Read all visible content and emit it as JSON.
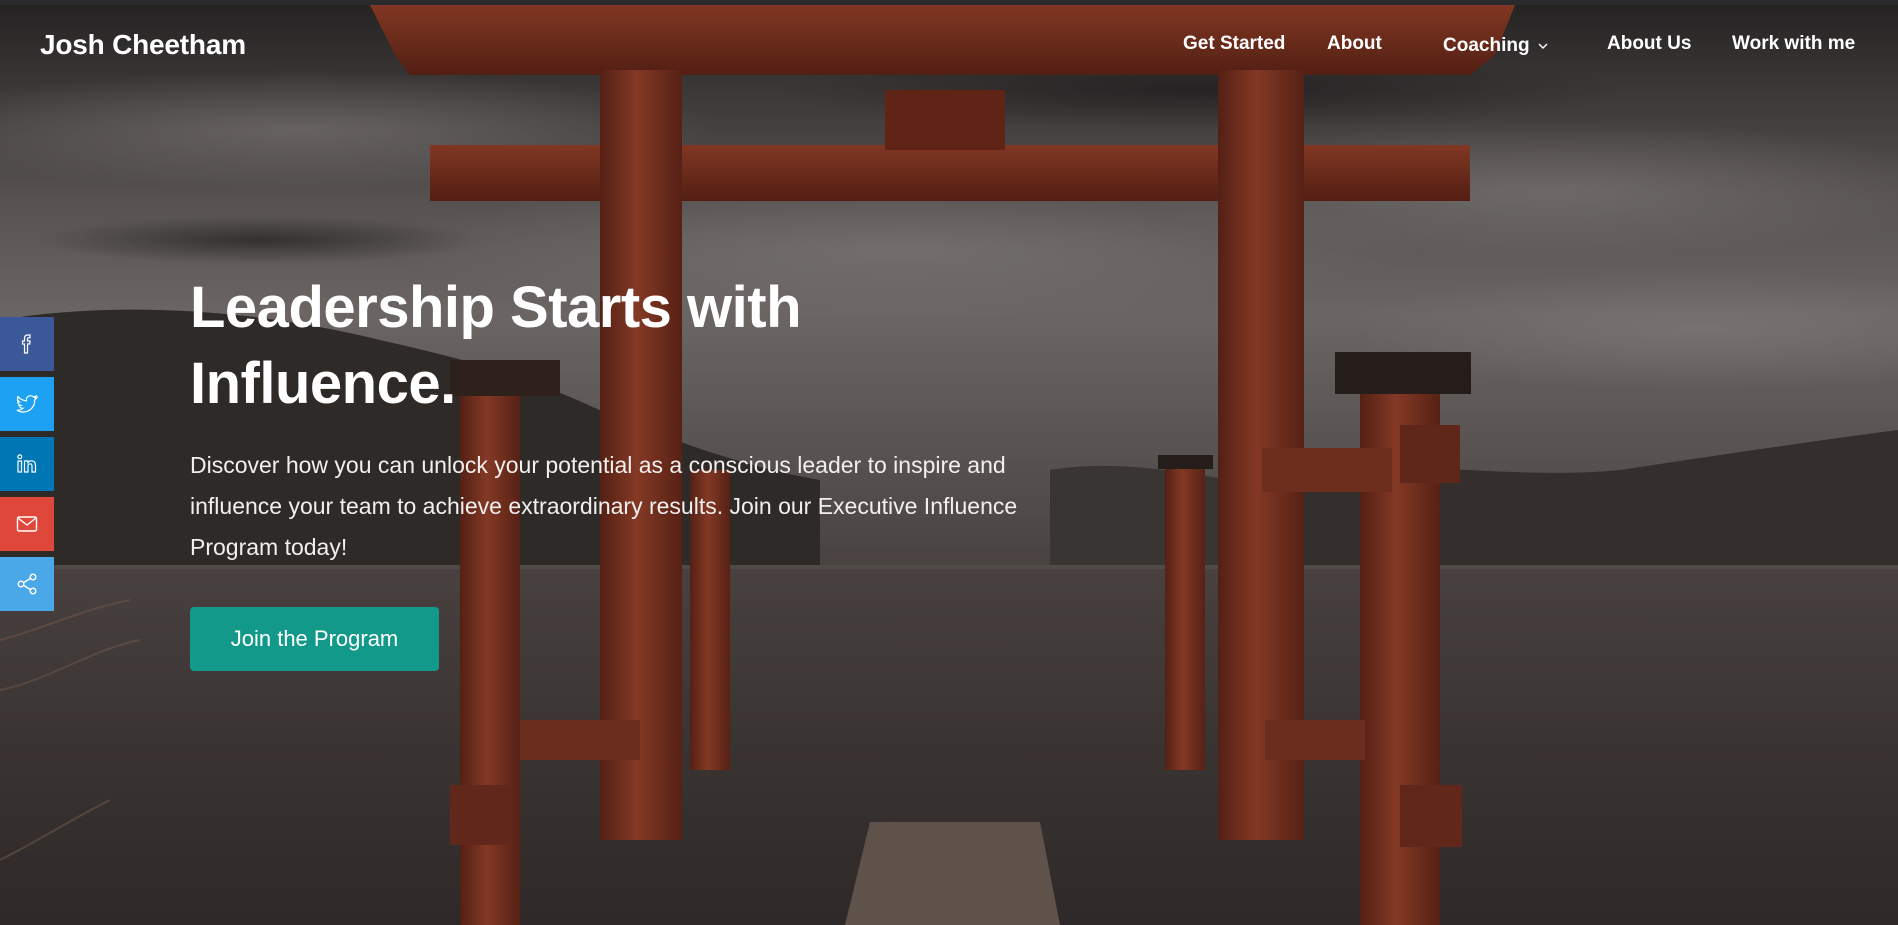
{
  "brand": "Josh Cheetham",
  "nav": {
    "items": [
      {
        "label": "Get Started"
      },
      {
        "label": "About"
      },
      {
        "label": "Coaching",
        "has_dropdown": true
      },
      {
        "label": "About Us"
      },
      {
        "label": "Work with me"
      }
    ]
  },
  "hero": {
    "title_line1": "Leadership Starts with",
    "title_line2": "Influence.",
    "description": "Discover how you can unlock your potential as a conscious leader to inspire and influence your team to achieve extraordinary results. Join our Executive Influence Program today!",
    "cta_label": "Join the Program",
    "background": "torii-gate-lake-photo"
  },
  "share": {
    "buttons": [
      {
        "name": "facebook",
        "icon": "facebook-icon",
        "color": "#3b5998"
      },
      {
        "name": "twitter",
        "icon": "twitter-icon",
        "color": "#1da1f2"
      },
      {
        "name": "linkedin",
        "icon": "linkedin-icon",
        "color": "#0077b5"
      },
      {
        "name": "email",
        "icon": "mail-icon",
        "color": "#e0473b"
      },
      {
        "name": "share",
        "icon": "share-icon",
        "color": "#4aa8e8"
      }
    ]
  },
  "colors": {
    "accent": "#13998a",
    "text": "#ffffff"
  }
}
